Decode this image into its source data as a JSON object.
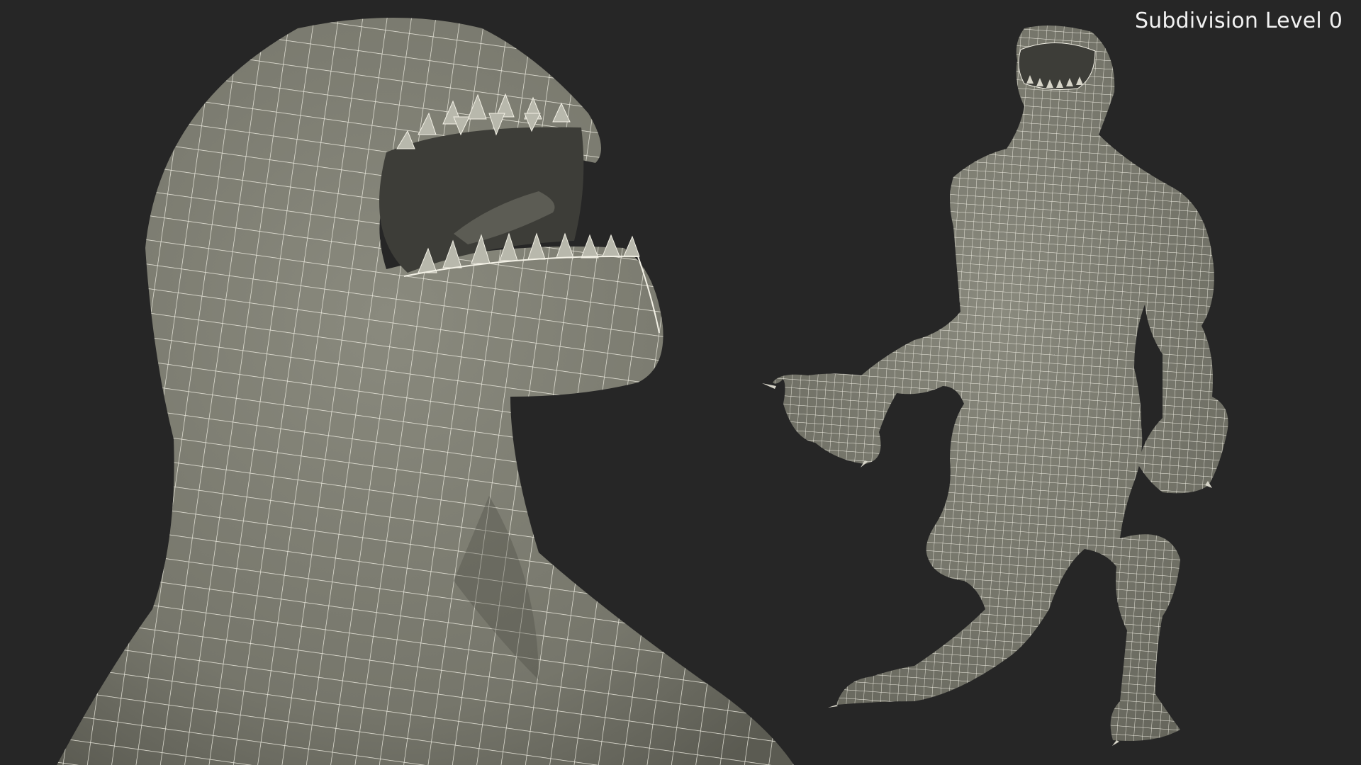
{
  "overlay": {
    "subdivision_label": "Subdivision Level 0"
  },
  "scene": {
    "background_color": "#262626",
    "mesh_fill": "#7e7e72",
    "mesh_shadow": "#4a4a43",
    "mouth_interior": "#3d3d38",
    "wire_color": "#f3f1e6"
  }
}
